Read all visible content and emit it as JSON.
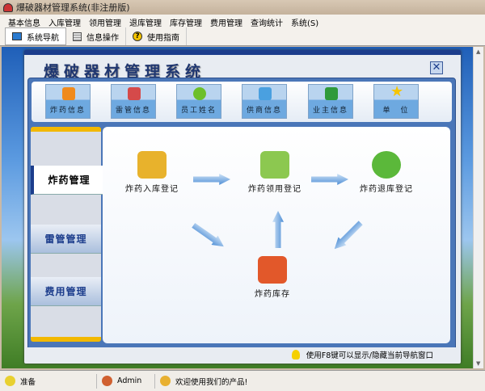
{
  "window": {
    "title": "爆破器材管理系统(非注册版)"
  },
  "menu": [
    "基本信息",
    "入库管理",
    "领用管理",
    "退库管理",
    "库存管理",
    "费用管理",
    "查询统计",
    "系统(S)"
  ],
  "toolbar": [
    {
      "label": "系统导航",
      "icon": "monitor-icon"
    },
    {
      "label": "信息操作",
      "icon": "grid-icon"
    },
    {
      "label": "使用指南",
      "icon": "help-icon"
    }
  ],
  "dialog": {
    "title": "爆破器材管理系统",
    "close": "✕"
  },
  "quick": [
    {
      "label": "炸药信息",
      "color": "#f08a1c"
    },
    {
      "label": "雷管信息",
      "color": "#d54a4a"
    },
    {
      "label": "员工姓名",
      "color": "#6cbf2a"
    },
    {
      "label": "供商信息",
      "color": "#4aa0e0"
    },
    {
      "label": "业主信息",
      "color": "#2f9a3a"
    },
    {
      "label": "单　位",
      "color": "#f5d000"
    }
  ],
  "tabs": [
    "炸药管理",
    "雷管管理",
    "费用管理"
  ],
  "flow": {
    "inbound": "炸药入库登记",
    "use": "炸药领用登记",
    "ret": "炸药退库登记",
    "stock": "炸药库存"
  },
  "hint": "使用F8键可以显示/隐藏当前导航窗口",
  "status": {
    "ready": "准备",
    "user": "Admin",
    "welcome": "欢迎使用我们的产品!"
  }
}
